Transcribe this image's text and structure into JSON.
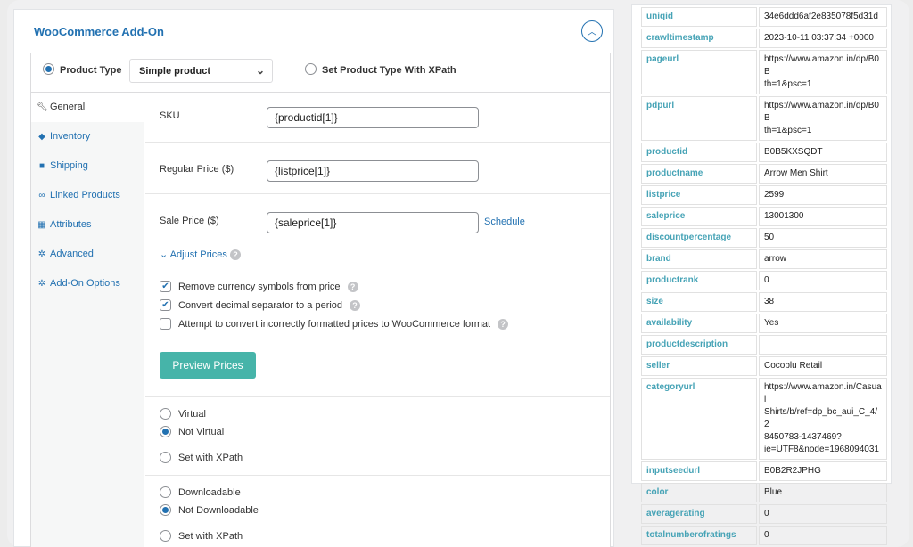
{
  "panel": {
    "title": "WooCommerce Add-On",
    "collapse_icon": "chevron-up-icon"
  },
  "product_type": {
    "label": "Product Type",
    "selected": "Simple product",
    "xpath_option": "Set Product Type With XPath"
  },
  "tabs": [
    {
      "label": "General",
      "icon": "wrench-icon",
      "active": true
    },
    {
      "label": "Inventory",
      "icon": "tag-icon"
    },
    {
      "label": "Shipping",
      "icon": "truck-icon"
    },
    {
      "label": "Linked Products",
      "icon": "link-icon"
    },
    {
      "label": "Attributes",
      "icon": "table-icon"
    },
    {
      "label": "Advanced",
      "icon": "gear-icon"
    },
    {
      "label": "Add-On Options",
      "icon": "gear-icon"
    }
  ],
  "fields": {
    "sku": {
      "label": "SKU",
      "value": "{productid[1]}"
    },
    "regular_price": {
      "label": "Regular Price ($)",
      "value": "{listprice[1]}"
    },
    "sale_price": {
      "label": "Sale Price ($)",
      "value": "{saleprice[1]}",
      "schedule": "Schedule"
    }
  },
  "adjust": {
    "label": "Adjust Prices",
    "options": [
      {
        "label": "Remove currency symbols from price",
        "checked": true
      },
      {
        "label": "Convert decimal separator to a period",
        "checked": true
      },
      {
        "label": "Attempt to convert incorrectly formatted prices to WooCommerce format",
        "checked": false
      }
    ],
    "preview_button": "Preview Prices"
  },
  "virtual_group": {
    "options": [
      "Virtual",
      "Not Virtual",
      "Set with XPath"
    ],
    "selected": 1
  },
  "download_group": {
    "options": [
      "Downloadable",
      "Not Downloadable",
      "Set with XPath"
    ],
    "selected": 1
  },
  "table": [
    {
      "key": "uniqid",
      "value": "34e6ddd6af2e835078f5d31d"
    },
    {
      "key": "crawltimestamp",
      "value": "2023-10-11 03:37:34 +0000"
    },
    {
      "key": "pageurl",
      "value": "https://www.amazon.in/dp/B0B\nth=1&psc=1"
    },
    {
      "key": "pdpurl",
      "value": "https://www.amazon.in/dp/B0B\nth=1&psc=1"
    },
    {
      "key": "productid",
      "value": "B0B5KXSQDT"
    },
    {
      "key": "productname",
      "value": "Arrow Men Shirt"
    },
    {
      "key": "listprice",
      "value": "2599"
    },
    {
      "key": "saleprice",
      "value": "13001300"
    },
    {
      "key": "discountpercentage",
      "value": "50"
    },
    {
      "key": "brand",
      "value": "arrow"
    },
    {
      "key": "productrank",
      "value": "0"
    },
    {
      "key": "size",
      "value": "38"
    },
    {
      "key": "availability",
      "value": "Yes"
    },
    {
      "key": "productdescription",
      "value": ""
    },
    {
      "key": "seller",
      "value": "Cocoblu Retail"
    },
    {
      "key": "categoryurl",
      "value": "https://www.amazon.in/Casual\nShirts/b/ref=dp_bc_aui_C_4/2\n8450783-1437469?\nie=UTF8&node=1968094031"
    },
    {
      "key": "inputseedurl",
      "value": "B0B2R2JPHG"
    },
    {
      "key": "color",
      "value": "Blue"
    },
    {
      "key": "averagerating",
      "value": "0"
    },
    {
      "key": "totalnumberofratings",
      "value": "0"
    },
    {
      "key": "type",
      "value": ""
    }
  ]
}
